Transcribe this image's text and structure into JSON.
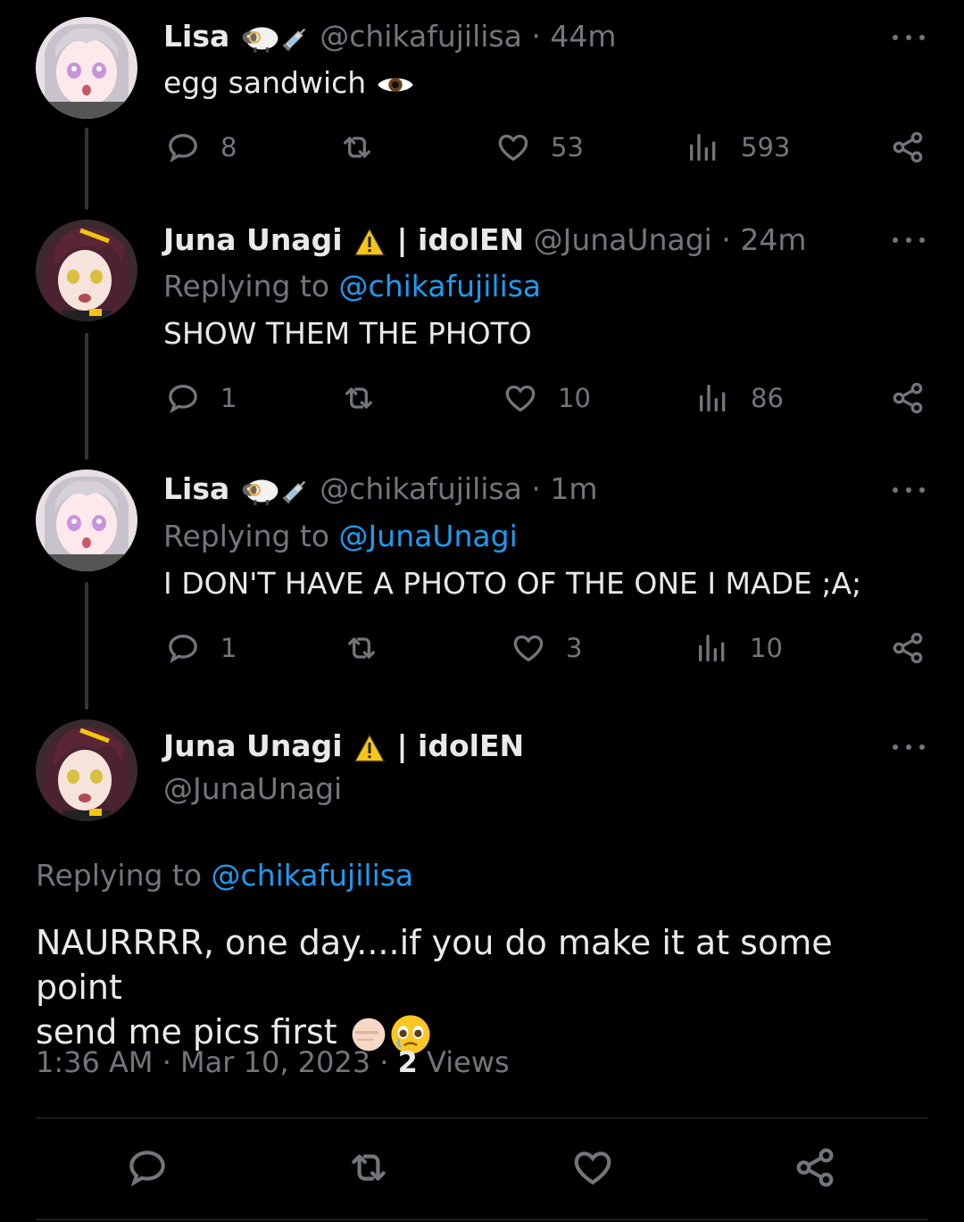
{
  "tweets": [
    {
      "name": "Lisa",
      "handle": "@chikafujilisa",
      "time": "44m",
      "replying_to": "",
      "text": "egg sandwich",
      "text_emoji": "👁️",
      "replies": "8",
      "retweets": "",
      "likes": "53",
      "views": "593"
    },
    {
      "name": "Juna Unagi",
      "name_suffix": "| idolEN",
      "handle": "@JunaUnagi",
      "time": "24m",
      "replying_label": "Replying to",
      "replying_to": "@chikafujilisa",
      "text": "SHOW THEM THE PHOTO",
      "replies": "1",
      "retweets": "",
      "likes": "10",
      "views": "86"
    },
    {
      "name": "Lisa",
      "handle": "@chikafujilisa",
      "time": "1m",
      "replying_label": "Replying to",
      "replying_to": "@JunaUnagi",
      "text": "I DON'T HAVE A PHOTO OF THE ONE I MADE ;A;",
      "replies": "1",
      "retweets": "",
      "likes": "3",
      "views": "10"
    }
  ],
  "main_tweet": {
    "name": "Juna Unagi",
    "name_suffix": "| idolEN",
    "handle": "@JunaUnagi",
    "replying_label": "Replying to",
    "replying_to": "@chikafujilisa",
    "text_line1": "NAURRRR, one day....if you do make it at some point",
    "text_line2": "send me pics first",
    "time": "1:36 AM",
    "date": "Mar 10, 2023",
    "views_count": "2",
    "views_label": "Views"
  },
  "separator": "·",
  "colors": {
    "background": "#000000",
    "text": "#e7e9ea",
    "muted": "#71767b",
    "link": "#1d9bf0"
  },
  "icons": [
    "reply-icon",
    "retweet-icon",
    "like-icon",
    "views-icon",
    "share-icon",
    "more-icon",
    "warning-icon",
    "sheep-icon",
    "syringe-icon",
    "eye-icon"
  ]
}
